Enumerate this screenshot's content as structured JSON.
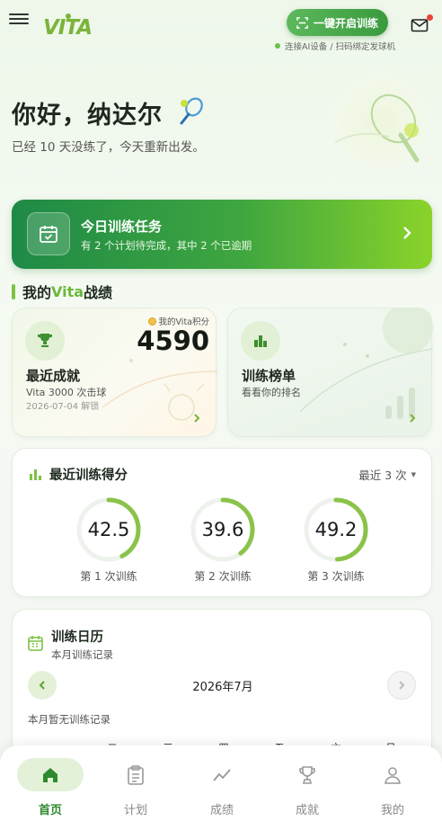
{
  "header": {
    "logo_text": "VITA",
    "start_label": "一键开启训练",
    "connect_hint": "连接AI设备 / 扫码绑定发球机",
    "mail_unread": true
  },
  "greeting": {
    "title": "你好，纳达尔",
    "subtitle": "已经 10 天没练了，今天重新出发。"
  },
  "task": {
    "title": "今日训练任务",
    "subtitle": "有 2 个计划待完成，其中 2 个已逾期"
  },
  "record": {
    "title_prefix": "我的",
    "title_brand": "Vita",
    "title_suffix": "战绩"
  },
  "achievement": {
    "points_label": "我的Vita积分",
    "points": "4590",
    "title": "最近成就",
    "name": "Vita 3000 次击球",
    "date": "2026-07-04 解锁"
  },
  "ranking": {
    "title": "训练榜单",
    "subtitle": "看看你的排名"
  },
  "scores": {
    "title": "最近训练得分",
    "selector": "最近 3 次",
    "items": [
      {
        "value": "42.5",
        "label": "第 1 次训练",
        "fraction": 0.425
      },
      {
        "value": "39.6",
        "label": "第 2 次训练",
        "fraction": 0.396
      },
      {
        "value": "49.2",
        "label": "第 3 次训练",
        "fraction": 0.492
      }
    ]
  },
  "calendar": {
    "title": "训练日历",
    "subtitle": "本月训练记录",
    "month": "2026年7月",
    "empty": "本月暂无训练记录",
    "weekdays": [
      "一",
      "二",
      "三",
      "四",
      "五",
      "六",
      "日"
    ]
  },
  "tabs": [
    {
      "label": "首页",
      "icon": "home-icon",
      "active": true
    },
    {
      "label": "计划",
      "icon": "clipboard-icon",
      "active": false
    },
    {
      "label": "成绩",
      "icon": "trend-icon",
      "active": false
    },
    {
      "label": "成就",
      "icon": "trophy-icon",
      "active": false
    },
    {
      "label": "我的",
      "icon": "user-icon",
      "active": false
    }
  ],
  "colors": {
    "accent": "#6cb83c",
    "ring": "#8bc34a",
    "task_gradient_start": "#1e8a47",
    "task_gradient_end": "#8ad32a",
    "active_tab": "#2f8a2f"
  }
}
